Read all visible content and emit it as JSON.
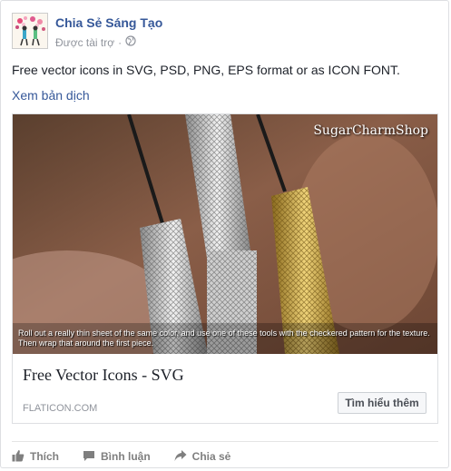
{
  "header": {
    "page_name": "Chia Sẻ Sáng Tạo",
    "sponsored_label": "Được tài trợ",
    "separator": "·"
  },
  "post": {
    "text": "Free vector icons in SVG, PSD, PNG, EPS format or as ICON FONT.",
    "translate_link": "Xem bản dịch"
  },
  "media": {
    "watermark": "SugarCharmShop",
    "caption": "Roll out a really thin sheet of the same color, and use one of these tools with the checkered pattern for the texture. Then wrap that around the first piece."
  },
  "link_preview": {
    "title": "Free Vector Icons - SVG",
    "domain": "FLATICON.COM",
    "cta_label": "Tìm hiểu thêm"
  },
  "actions": {
    "like": "Thích",
    "comment": "Bình luận",
    "share": "Chia sẻ"
  },
  "colors": {
    "link_blue": "#365899",
    "text": "#1d2129",
    "muted": "#90949c"
  }
}
